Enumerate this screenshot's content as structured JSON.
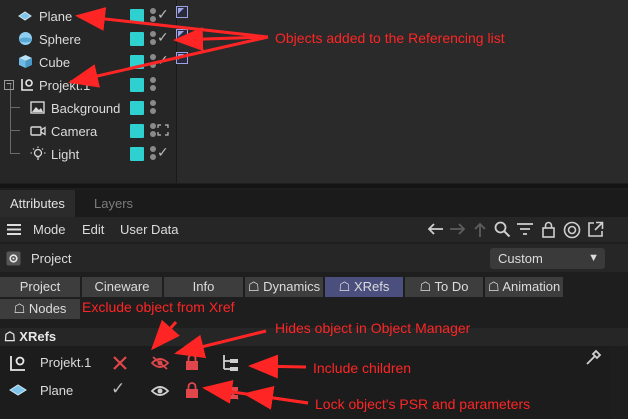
{
  "objects": [
    {
      "label": "Plane",
      "icon": "plane-icon"
    },
    {
      "label": "Sphere",
      "icon": "sphere-icon"
    },
    {
      "label": "Cube",
      "icon": "cube-icon"
    },
    {
      "label": "Projekt.1",
      "icon": "null-object-icon"
    },
    {
      "label": "Background",
      "icon": "image-icon"
    },
    {
      "label": "Camera",
      "icon": "camera-icon"
    },
    {
      "label": "Light",
      "icon": "light-icon"
    }
  ],
  "tabs": {
    "attributes": "Attributes",
    "layers": "Layers"
  },
  "menu": {
    "mode": "Mode",
    "edit": "Edit",
    "user_data": "User Data"
  },
  "project": {
    "label": "Project",
    "preset": "Custom"
  },
  "prop_tabs": [
    "Project",
    "Cineware",
    "Info",
    "Dynamics",
    "XRefs",
    "To Do",
    "Animation",
    "Nodes"
  ],
  "xrefs": {
    "section": "XRefs",
    "rows": [
      {
        "label": "Projekt.1"
      },
      {
        "label": "Plane"
      }
    ]
  },
  "annotations": {
    "a1": "Objects added to the Referencing list",
    "a2": "Exclude object from Xref",
    "a3": "Hides object in Object Manager",
    "a4": "Include children",
    "a5": "Lock object's PSR and parameters"
  },
  "colors": {
    "tag": "#2fd0d0",
    "annotation": "#ff2525",
    "active_tab": "#4a4f7d",
    "lock": "#e0474c"
  }
}
